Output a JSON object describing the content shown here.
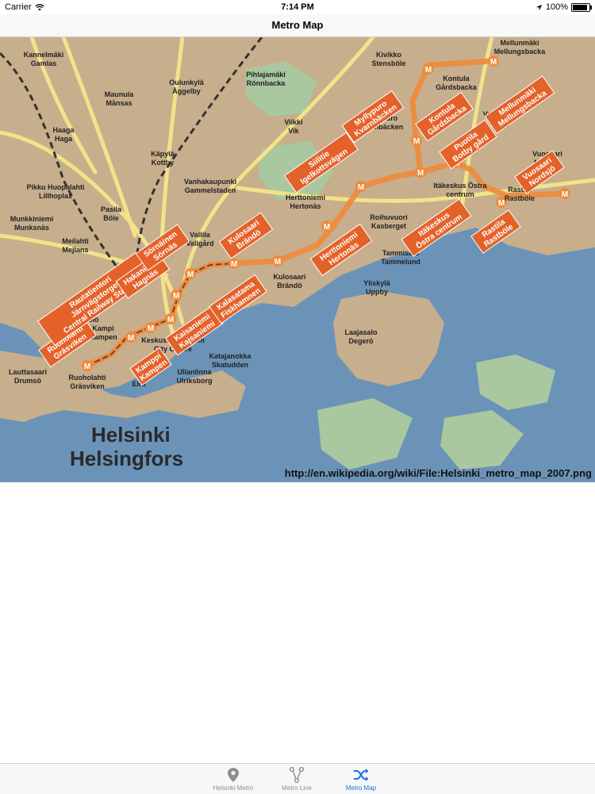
{
  "status_bar": {
    "carrier": "Carrier",
    "time": "7:14 PM",
    "battery": "100%",
    "battery_level": 1.0
  },
  "nav": {
    "title": "Metro Map"
  },
  "map": {
    "city_name_fi": "Helsinki",
    "city_name_sv": "Helsingfors",
    "attribution": "http://en.wikipedia.org/wiki/File:Helsinki_metro_map_2007.png",
    "colors": {
      "water": "#6b93b8",
      "land": "#c7ae8c",
      "park": "#a9c8a0",
      "roads": "#f2e28a",
      "metro": "#f08a3a",
      "tag": "#e4622a"
    },
    "districts": [
      "Kannelmäki Gamlas",
      "Maunula Månsas",
      "Oulunkylä Åggelby",
      "Pihlajamäki Rönnbacka",
      "Kivikko Stensböle",
      "Mellunmäki Mellungsbacka",
      "Kontula Gårdsbacka",
      "Vartiokylä Botby",
      "Haaga Haga",
      "Käpylä Kottby",
      "Viikki Vik",
      "Myllypuro Kvarnbäcken",
      "Vanhakaupunki Gammelstaden",
      "Pikku Huopalahti Lillhoplax",
      "Pasila Böle",
      "Herttoniemi Hertonäs",
      "Itäkeskus Östra centrum",
      "Vuosaari Nordsjö",
      "Rastila Rastböle",
      "Munkkiniemi Munksnäs",
      "Vallila Vallgård",
      "Roihuvuori Kasberget",
      "Meilahti Mejlans",
      "Tammisalo Tammelund",
      "Kulosaari Brändö",
      "Yliskylä Uppby",
      "Töölö Tölö",
      "Kampi Kampen",
      "Keskusta Centrum City Centre",
      "Katajanokka Skatudden",
      "Laajasalo Degerö",
      "Lauttasaari Drumsö",
      "Ruoholahti Gräsviken",
      "Ullanlinna Ulriksborg",
      "Eira"
    ],
    "stations": [
      "Ruoholahti Gräsviken",
      "Kamppi Kampen",
      "Rautatientori Järnvägstorget Central Railway Station",
      "Kaisaniemi Kajsaniemi",
      "Hakaniemi Hagnäs",
      "Sörnäinen Sörnäs",
      "Kalasatama Fiskhamnen",
      "Kulosaari Brändö",
      "Herttoniemi Hertonäs",
      "Siilitie Igelkottsvägen",
      "Itäkeskus Östra centrum",
      "Myllypuro Kvarnbäcken",
      "Kontula Gårdsbacka",
      "Mellunmäki Mellungsbacka",
      "Puotila Botby gård",
      "Rastila Rastböle",
      "Vuosaari Nordsjö"
    ]
  },
  "tabs": [
    {
      "label": "Helsinki Metro",
      "icon": "map-pin-icon",
      "active": false
    },
    {
      "label": "Metro Line",
      "icon": "line-nodes-icon",
      "active": false
    },
    {
      "label": "Metro Map",
      "icon": "shuffle-icon",
      "active": true
    }
  ]
}
